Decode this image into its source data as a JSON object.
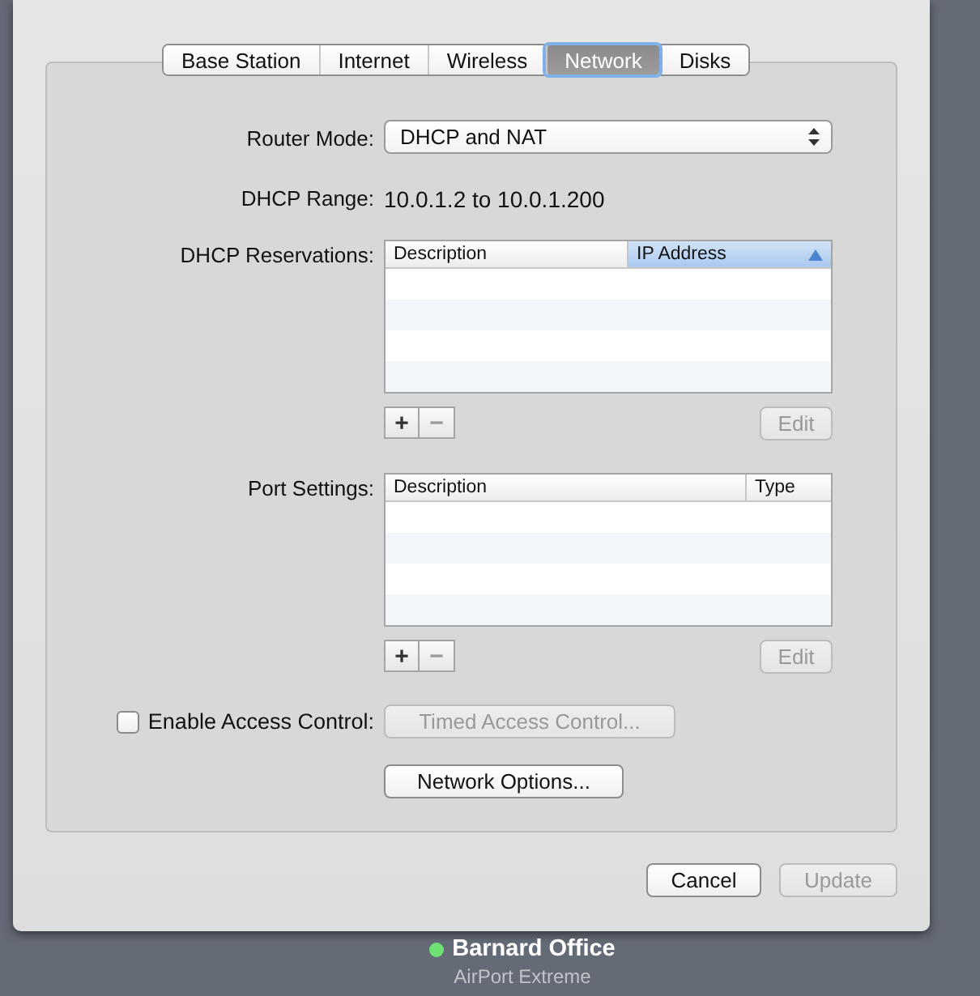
{
  "tabs": [
    {
      "label": "Base Station",
      "selected": false
    },
    {
      "label": "Internet",
      "selected": false
    },
    {
      "label": "Wireless",
      "selected": false
    },
    {
      "label": "Network",
      "selected": true
    },
    {
      "label": "Disks",
      "selected": false
    }
  ],
  "router_mode": {
    "label": "Router Mode:",
    "value": "DHCP and NAT"
  },
  "dhcp_range": {
    "label": "DHCP Range:",
    "value": "10.0.1.2 to 10.0.1.200"
  },
  "dhcp_reservations": {
    "label": "DHCP Reservations:",
    "columns": [
      {
        "title": "Description",
        "sorted": false
      },
      {
        "title": "IP Address",
        "sorted": true
      }
    ],
    "add": "+",
    "remove": "−",
    "edit": {
      "label": "Edit",
      "disabled": true
    }
  },
  "port_settings": {
    "label": "Port Settings:",
    "columns": [
      {
        "title": "Description",
        "sorted": false
      },
      {
        "title": "Type",
        "sorted": false
      }
    ],
    "add": "+",
    "remove": "−",
    "edit": {
      "label": "Edit",
      "disabled": true
    }
  },
  "access_control": {
    "label": "Enable Access Control:",
    "checked": false,
    "button": {
      "label": "Timed Access Control...",
      "disabled": true
    }
  },
  "network_options": {
    "label": "Network Options...",
    "disabled": false
  },
  "buttons": [
    {
      "label": "Cancel",
      "disabled": false
    },
    {
      "label": "Update",
      "disabled": true
    }
  ],
  "device": {
    "name": "Barnard Office",
    "model": "AirPort Extreme"
  }
}
